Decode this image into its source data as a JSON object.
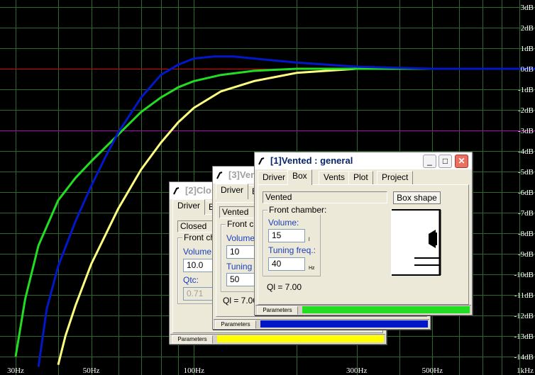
{
  "chart_data": {
    "type": "line",
    "x_scale": "log",
    "xlim": [
      27,
      1000
    ],
    "ylim": [
      -14,
      3
    ],
    "grid": true,
    "x_tick_labels": [
      "30Hz",
      "50Hz",
      "100Hz",
      "300Hz",
      "500Hz",
      "1kHz"
    ],
    "y_tick_labels": [
      "3dB",
      "2dB",
      "1dB",
      "0dB",
      "-1dB",
      "-2dB",
      "-3dB",
      "-4dB",
      "-5dB",
      "-6dB",
      "-7dB",
      "-8dB",
      "-9dB",
      "-10dB",
      "-11dB",
      "-12dB",
      "-13dB",
      "-14dB"
    ],
    "reference_lines": [
      {
        "y": 0,
        "color": "#e00000"
      },
      {
        "y": -3,
        "color": "#b000b0"
      }
    ],
    "series": [
      {
        "color": "#0018c8",
        "x": [
          35,
          37,
          40,
          45,
          50,
          55,
          60,
          70,
          80,
          90,
          100,
          115,
          130,
          150,
          200,
          300,
          500,
          1000
        ],
        "y": [
          -14.5,
          -11.7,
          -9.6,
          -7.4,
          -5.7,
          -4.3,
          -3.1,
          -1.4,
          -0.3,
          0.2,
          0.5,
          0.6,
          0.6,
          0.5,
          0.3,
          0.1,
          0.0,
          0.0
        ]
      },
      {
        "color": "#22dd22",
        "x": [
          30,
          32,
          35,
          40,
          45,
          50,
          60,
          70,
          80,
          90,
          100,
          120,
          150,
          200,
          300,
          500,
          1000
        ],
        "y": [
          -14,
          -11.2,
          -8.6,
          -6.4,
          -5.3,
          -4.5,
          -3.2,
          -2.1,
          -1.4,
          -0.9,
          -0.6,
          -0.3,
          -0.1,
          0.0,
          0.0,
          0.0,
          0.0
        ]
      },
      {
        "color": "#ffff80",
        "x": [
          40,
          42,
          45,
          50,
          60,
          70,
          80,
          90,
          100,
          120,
          150,
          200,
          300,
          500,
          1000
        ],
        "y": [
          -14.4,
          -13,
          -11.5,
          -9.5,
          -6.8,
          -4.9,
          -3.6,
          -2.6,
          -1.9,
          -1.1,
          -0.6,
          -0.2,
          0.0,
          0.0,
          0.0
        ]
      }
    ]
  },
  "windows": {
    "closed": {
      "title": "[2]Closed",
      "tabs": [
        "Driver",
        "Box"
      ],
      "type_value": "Closed",
      "group_title": "Front chamber:",
      "volume_label": "Volume:",
      "volume_value": "10.0",
      "qtc_label": "Qtc:",
      "qtc_value": "0.71",
      "status_label": "Parameters",
      "status_color": "#ffff00"
    },
    "vented3": {
      "title": "[3]Vented",
      "tabs": [
        "Driver",
        "Box"
      ],
      "type_value": "Vented",
      "group_title": "Front chamber:",
      "volume_label": "Volume:",
      "volume_value": "10",
      "tuning_label": "Tuning freq.:",
      "tuning_value": "50",
      "ql_text": "Ql = 7.00",
      "status_label": "Parameters",
      "status_color": "#0018c8"
    },
    "vented1": {
      "title": "[1]Vented : general",
      "tabs": [
        "Driver",
        "Box",
        "Vents",
        "Plot",
        "Project"
      ],
      "type_value": "Vented",
      "box_shape_button": "Box shape",
      "group_title": "Front chamber:",
      "volume_label": "Volume:",
      "volume_value": "15",
      "volume_unit": "l",
      "tuning_label": "Tuning freq.:",
      "tuning_value": "40",
      "tuning_unit": "Hz",
      "ql_text": "Ql = 7.00",
      "status_label": "Parameters",
      "status_color": "#22dd22"
    }
  }
}
